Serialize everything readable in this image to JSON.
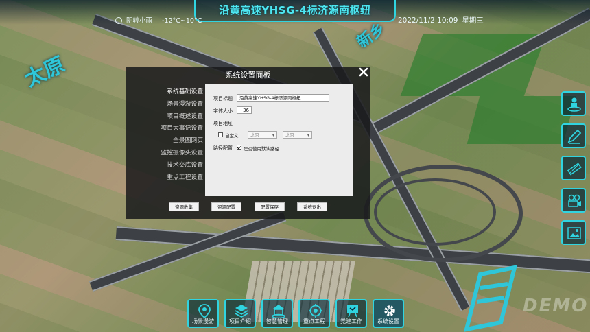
{
  "header": {
    "title": "沿黄高速YHSG-4标济源南枢纽",
    "weather_text": "阴转小雨",
    "temperature": "-12°C~10°C",
    "date_time": "2022/11/2 10:09",
    "weekday": "星期三"
  },
  "map_labels": {
    "northwest": "太原",
    "northeast": "新乡"
  },
  "watermark": "DEMO",
  "dialog": {
    "title": "系统设置面板",
    "close_icon": "close-icon",
    "menu": [
      {
        "label": "系统基础设置",
        "active": true
      },
      {
        "label": "场景漫游设置",
        "active": false
      },
      {
        "label": "项目概述设置",
        "active": false
      },
      {
        "label": "项目大事记设置",
        "active": false
      },
      {
        "label": "全景图网页",
        "active": false
      },
      {
        "label": "监控摄像头设置",
        "active": false
      },
      {
        "label": "技术交底设置",
        "active": false
      },
      {
        "label": "重点工程设置",
        "active": false
      }
    ],
    "form": {
      "project_title_label": "项目标题",
      "project_title_value": "沿黄高速YHSG-4标济源南枢纽",
      "font_size_label": "字体大小",
      "font_size_value": "36",
      "address_label": "项目地址",
      "custom_label": "自定义",
      "custom_checked": false,
      "province_value": "北京",
      "city_value": "北京",
      "route_label": "路径配置",
      "default_route_label": "是否使用默认路径",
      "default_route_checked": true
    },
    "buttons": {
      "collect": "资源收集",
      "config": "资源配置",
      "save": "配置保存",
      "exit": "系统退出"
    }
  },
  "right_toolbar": [
    {
      "icon": "person-location-icon"
    },
    {
      "icon": "pen-edit-icon"
    },
    {
      "icon": "ruler-measure-icon"
    },
    {
      "icon": "camera-monitor-icon"
    },
    {
      "icon": "image-gallery-icon"
    }
  ],
  "bottom_nav": [
    {
      "label": "场景漫游",
      "icon": "location-pin-icon",
      "active": false
    },
    {
      "label": "项目介绍",
      "icon": "layers-icon",
      "active": false
    },
    {
      "label": "智慧管理",
      "icon": "building-icon",
      "active": false
    },
    {
      "label": "重点工程",
      "icon": "gear-target-icon",
      "active": false
    },
    {
      "label": "党建工作",
      "icon": "flag-board-icon",
      "active": false
    },
    {
      "label": "系统设置",
      "icon": "gear-icon",
      "active": true
    }
  ],
  "colors": {
    "accent": "#2fd4e0",
    "title": "#4ee6f0",
    "dialog_bg": "#18191b",
    "panel_bg": "#ececec"
  }
}
